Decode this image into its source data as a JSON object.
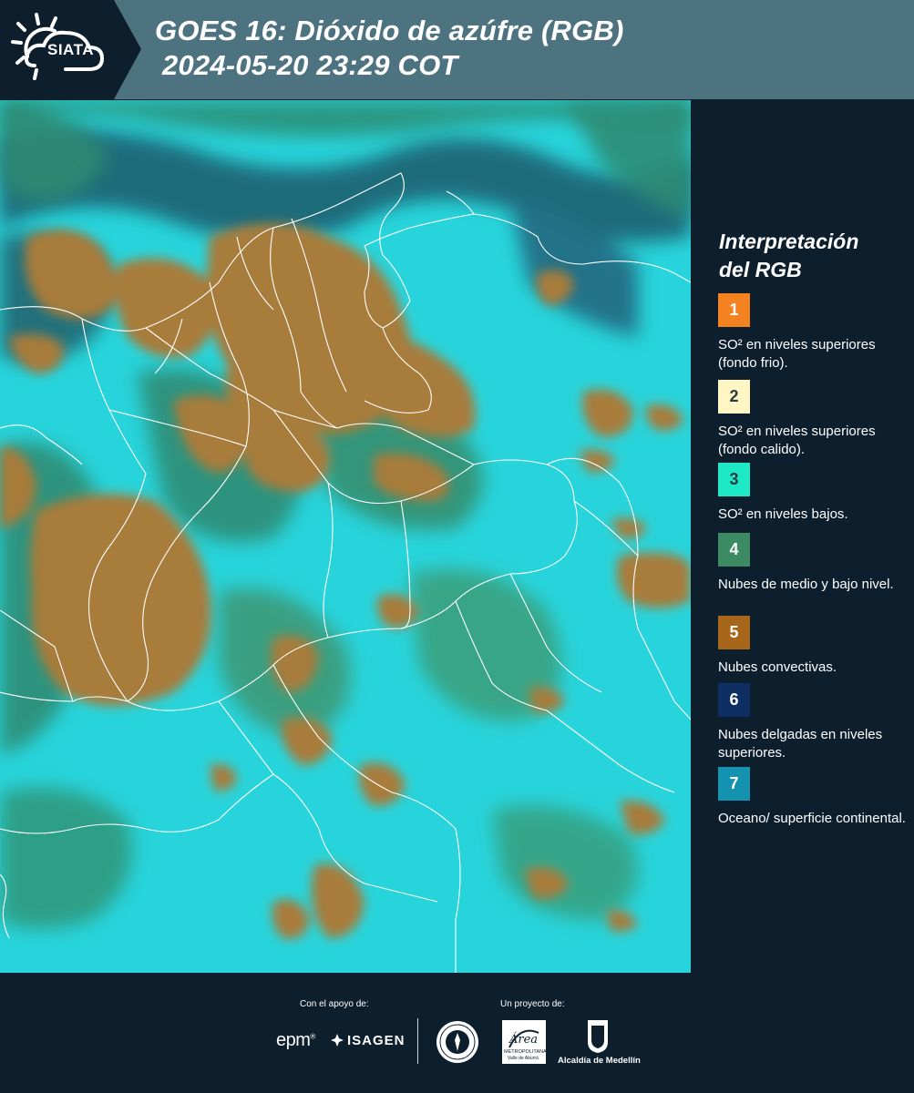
{
  "header": {
    "logo_text": "SIATA",
    "title_line1": "GOES 16: Dióxido de azúfre (RGB)",
    "title_line2": "2024-05-20 23:29 COT"
  },
  "legend": {
    "title_line1": "Interpretación",
    "title_line2": "del RGB",
    "items": [
      {
        "number": "1",
        "color": "#f58220",
        "number_color": "#ffffff",
        "text": "SO² en niveles superiores (fondo frio)."
      },
      {
        "number": "2",
        "color": "#fff6c4",
        "number_color": "#2b3a42",
        "text": "SO² en niveles superiores (fondo calido)."
      },
      {
        "number": "3",
        "color": "#1de9c6",
        "number_color": "#2b3a42",
        "text": "SO² en niveles bajos."
      },
      {
        "number": "4",
        "color": "#3d8b63",
        "number_color": "#ffffff",
        "text": "Nubes de medio y bajo nivel."
      },
      {
        "number": "5",
        "color": "#a8661a",
        "number_color": "#ffffff",
        "text": "Nubes convectivas."
      },
      {
        "number": "6",
        "color": "#0f2e63",
        "number_color": "#ffffff",
        "text": "Nubes delgadas en niveles superiores."
      },
      {
        "number": "7",
        "color": "#1592b0",
        "number_color": "#ffffff",
        "text": "Oceano/ superficie continental."
      }
    ]
  },
  "map": {
    "ocean_color": "#28d4db",
    "convective_cloud_color": "#a87c3a",
    "mid_low_cloud_color": "#2f8c74",
    "thin_high_cloud_color": "#23506a",
    "border_color": "#ffffff"
  },
  "footer": {
    "support_label": "Con el apoyo de:",
    "project_label": "Un proyecto de:",
    "epm_text": "epm",
    "isagen_text": "ISAGEN",
    "area_text": "Área",
    "area_subtext": "METROPOLITANA",
    "area_subtext2": "Valle de Aburrá",
    "alcaldia_text": "Alcaldía de Medellín"
  }
}
